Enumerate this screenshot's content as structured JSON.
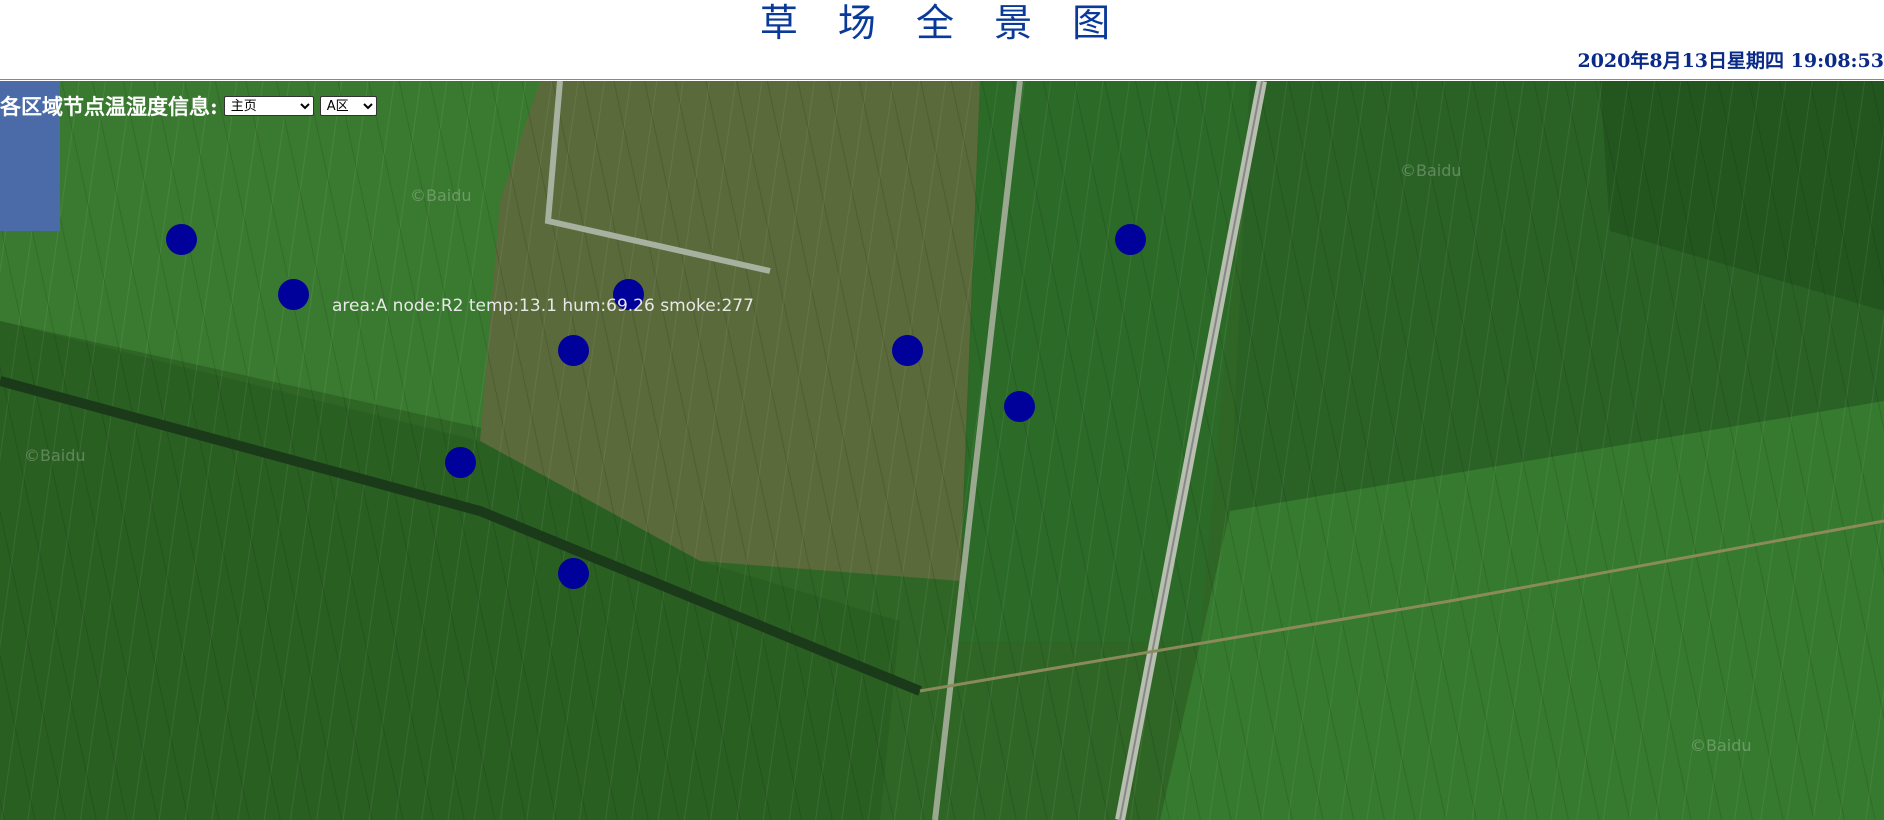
{
  "header": {
    "title": "草 场 全 景 图",
    "datetime": "2020年8月13日星期四 19:08:53"
  },
  "controls": {
    "label": "各区域节点温湿度信息:",
    "page_select": {
      "selected": "主页"
    },
    "area_select": {
      "selected": "A区"
    }
  },
  "map": {
    "watermark": "©Baidu",
    "nodes": [
      {
        "id": "node-1"
      },
      {
        "id": "node-2"
      },
      {
        "id": "node-3"
      },
      {
        "id": "node-4"
      },
      {
        "id": "node-5"
      },
      {
        "id": "node-6"
      },
      {
        "id": "node-7"
      },
      {
        "id": "node-8"
      },
      {
        "id": "node-9"
      }
    ],
    "tooltip": "area:A node:R2 temp:13.1 hum:69.26 smoke:277"
  },
  "colors": {
    "node": "#00009a",
    "title": "#0a3a99"
  }
}
